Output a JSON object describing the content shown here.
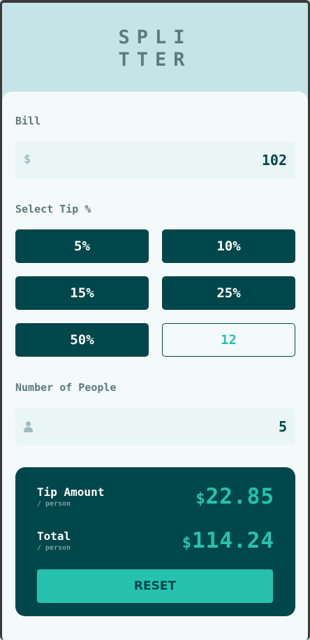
{
  "logo": {
    "line1": "SPLI",
    "line2": "TTER"
  },
  "bill": {
    "label": "Bill",
    "currency_symbol": "$",
    "value": "102"
  },
  "tip": {
    "label": "Select Tip %",
    "options": [
      "5%",
      "10%",
      "15%",
      "25%",
      "50%"
    ],
    "custom_value": "12"
  },
  "people": {
    "label": "Number of People",
    "value": "5",
    "icon": "person-icon"
  },
  "results": {
    "tip_amount": {
      "title": "Tip Amount",
      "sub": "/ person",
      "currency": "$",
      "value": "22.85"
    },
    "total": {
      "title": "Total",
      "sub": "/ person",
      "currency": "$",
      "value": "114.24"
    },
    "reset_label": "RESET"
  },
  "colors": {
    "dark_teal": "#00474b",
    "accent": "#26c2ad",
    "background": "#c5e4e7",
    "card": "#f4fafa",
    "input_bg": "#eaf6f6",
    "muted": "#5e7a7d"
  }
}
